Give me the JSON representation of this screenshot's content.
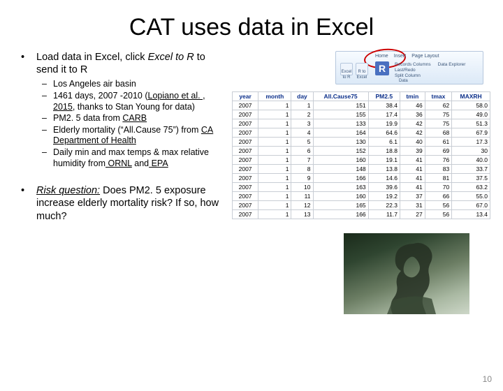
{
  "title": "CAT uses data in Excel",
  "bullets": {
    "b1_prefix": "Load data in Excel, click ",
    "b1_em": "Excel to R",
    "b1_suffix": " to send it to R",
    "risk_label": "Risk question:",
    "risk_text": "  Does PM2. 5 exposure increase elderly mortality risk?  If so, how much?"
  },
  "sub": {
    "s1": "Los Angeles air basin",
    "s2_a": "1461 days, 2007 -2010 (",
    "s2_link": "Lopiano et al. , 2015",
    "s2_b": ", thanks to Stan Young for data)",
    "s3_a": "PM2. 5 data from ",
    "s3_link": "CARB",
    "s4_a": "Elderly mortality (“All.Cause 75”) from ",
    "s4_link": "CA Department of Health",
    "s5_a": "Daily min and max temps & max relative humidity from",
    "s5_link1": " ORNL",
    "s5_and": " and",
    "s5_link2": " EPA"
  },
  "ribbon": {
    "tabs": [
      "Home",
      "Insert",
      "Page Layout"
    ],
    "bigR": "R",
    "left_icons": [
      "Excel to R",
      "R to Excel"
    ],
    "items": [
      "Records Columns",
      "Last/Redo",
      "Split Column"
    ],
    "right_col": "Data Explorer",
    "group": "Data"
  },
  "table": {
    "headers": [
      "year",
      "month",
      "day",
      "All.Cause75",
      "PM2.5",
      "tmin",
      "tmax",
      "MAXRH"
    ],
    "rows": [
      [
        "2007",
        "1",
        "1",
        "151",
        "38.4",
        "46",
        "62",
        "58.0"
      ],
      [
        "2007",
        "1",
        "2",
        "155",
        "17.4",
        "36",
        "75",
        "49.0"
      ],
      [
        "2007",
        "1",
        "3",
        "133",
        "19.9",
        "42",
        "75",
        "51.3"
      ],
      [
        "2007",
        "1",
        "4",
        "164",
        "64.6",
        "42",
        "68",
        "67.9"
      ],
      [
        "2007",
        "1",
        "5",
        "130",
        "6.1",
        "40",
        "61",
        "17.3"
      ],
      [
        "2007",
        "1",
        "6",
        "152",
        "18.8",
        "39",
        "69",
        "30"
      ],
      [
        "2007",
        "1",
        "7",
        "160",
        "19.1",
        "41",
        "76",
        "40.0"
      ],
      [
        "2007",
        "1",
        "8",
        "148",
        "13.8",
        "41",
        "83",
        "33.7"
      ],
      [
        "2007",
        "1",
        "9",
        "166",
        "14.6",
        "41",
        "81",
        "37.5"
      ],
      [
        "2007",
        "1",
        "10",
        "163",
        "39.6",
        "41",
        "70",
        "63.2"
      ],
      [
        "2007",
        "1",
        "11",
        "160",
        "19.2",
        "37",
        "66",
        "55.0"
      ],
      [
        "2007",
        "1",
        "12",
        "165",
        "22.3",
        "31",
        "56",
        "67.0"
      ],
      [
        "2007",
        "1",
        "13",
        "166",
        "11.7",
        "27",
        "56",
        "13.4"
      ]
    ]
  },
  "page_number": "10"
}
